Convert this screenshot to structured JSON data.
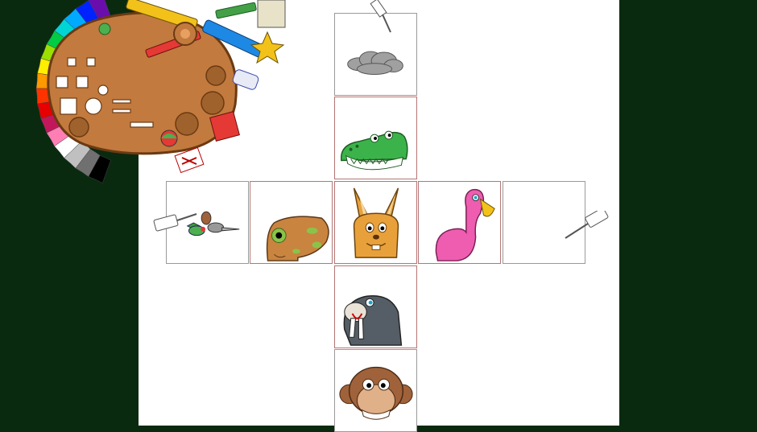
{
  "app": {
    "colors": {
      "background": "#0a2a10",
      "paper": "#ffffff",
      "grid_line": "#9a9a9a",
      "palette_wood": "#c27a3e"
    }
  },
  "palette": {
    "icon": "paint-palette-icon",
    "tools": [
      "crayon",
      "pencil",
      "marker",
      "brush",
      "stamp",
      "eraser",
      "scissors",
      "paint-can",
      "ball",
      "cutout-box"
    ],
    "rainbow_colors": [
      "#6a0dad",
      "#0022ff",
      "#00aaff",
      "#00d4d4",
      "#00cc44",
      "#9be000",
      "#ffee00",
      "#ff9900",
      "#ff3300",
      "#e60000",
      "#c2185b",
      "#ff7fb5",
      "#ffffff",
      "#c0c0c0",
      "#707070",
      "#000000"
    ]
  },
  "cube_net": {
    "faces": [
      {
        "row": 0,
        "col": 2,
        "content": "cloud"
      },
      {
        "row": 1,
        "col": 2,
        "content": "crocodile"
      },
      {
        "row": 2,
        "col": 0,
        "content": "small-animals"
      },
      {
        "row": 2,
        "col": 1,
        "content": "frog"
      },
      {
        "row": 2,
        "col": 2,
        "content": "rabbit"
      },
      {
        "row": 2,
        "col": 3,
        "content": "flamingo"
      },
      {
        "row": 2,
        "col": 4,
        "content": "empty"
      },
      {
        "row": 3,
        "col": 2,
        "content": "walrus"
      },
      {
        "row": 4,
        "col": 2,
        "content": "monkey"
      }
    ],
    "glue_tubes": 3
  }
}
